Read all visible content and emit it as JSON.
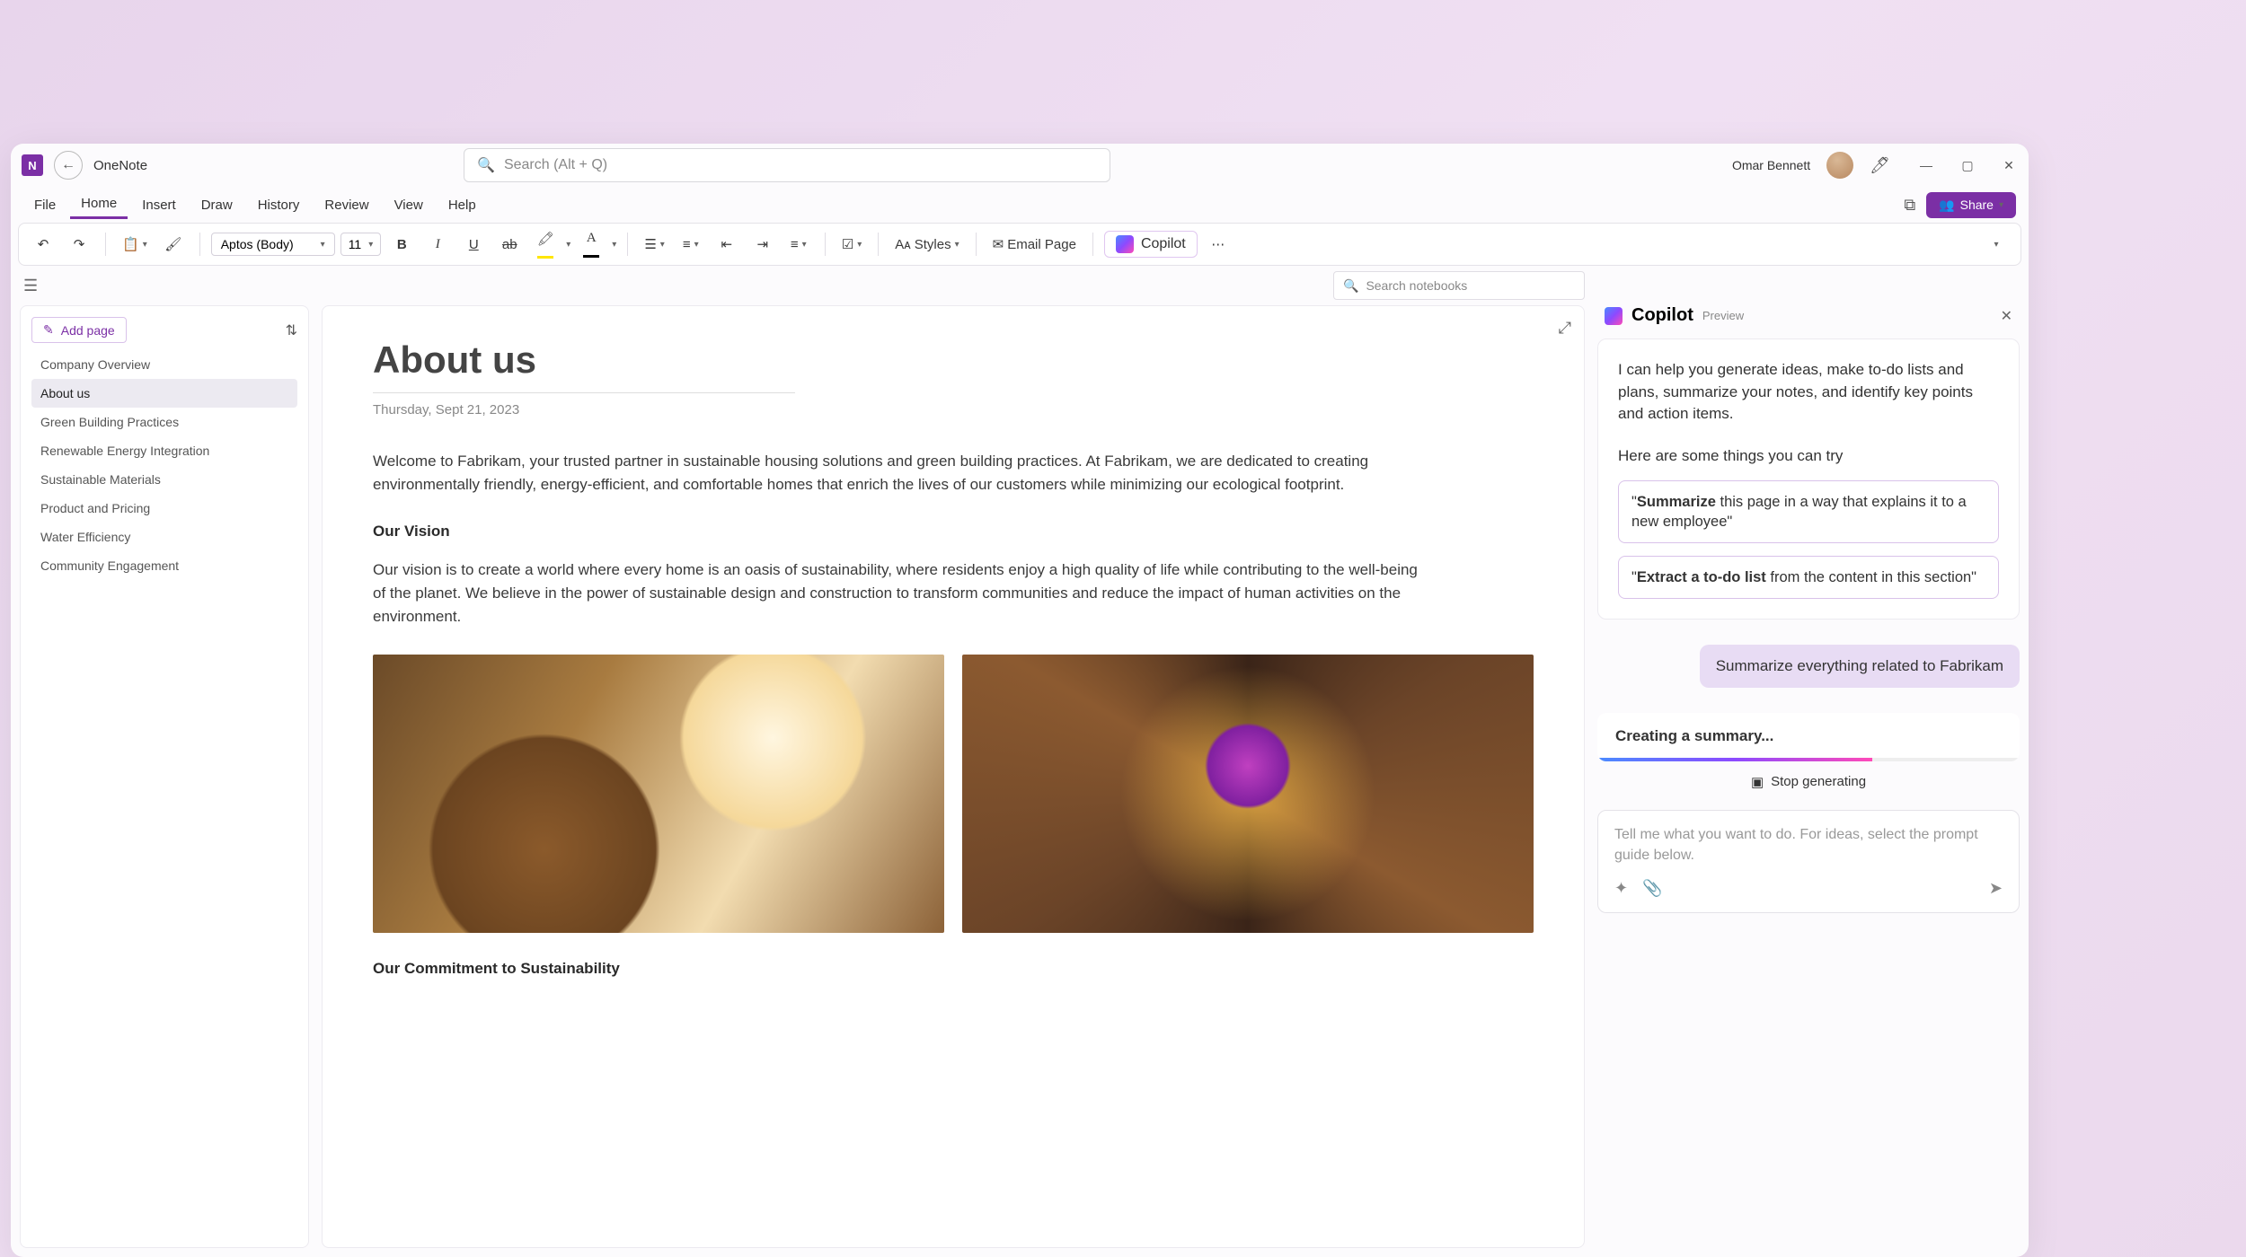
{
  "app": {
    "icon_letter": "N",
    "name": "OneNote",
    "search_placeholder": "Search (Alt + Q)",
    "username": "Omar Bennett"
  },
  "window_controls": {
    "minimize": "—",
    "maximize": "▢",
    "close": "✕"
  },
  "tabs": {
    "items": [
      "File",
      "Home",
      "Insert",
      "Draw",
      "History",
      "Review",
      "View",
      "Help"
    ],
    "active": "Home",
    "share_label": "Share"
  },
  "ribbon": {
    "font": "Aptos (Body)",
    "size": "11",
    "styles_label": "Styles",
    "email_label": "Email Page",
    "copilot_label": "Copilot"
  },
  "search_notebooks_placeholder": "Search notebooks",
  "sidebar": {
    "add_page_label": "Add page",
    "pages": [
      "Company Overview",
      "About us",
      "Green Building Practices",
      "Renewable Energy Integration",
      "Sustainable Materials",
      "Product and Pricing",
      "Water Efficiency",
      "Community Engagement"
    ],
    "active_index": 1
  },
  "page": {
    "title": "About us",
    "date": "Thursday, Sept 21, 2023",
    "intro": "Welcome to Fabrikam, your trusted partner in sustainable housing solutions and green building practices. At Fabrikam, we are dedicated to creating environmentally friendly, energy-efficient, and comfortable homes that enrich the lives of our customers while minimizing our ecological footprint.",
    "vision_head": "Our Vision",
    "vision_body": "Our vision is to create a world where every home is an oasis of sustainability, where residents enjoy a high quality of life while contributing to the well-being of the planet. We believe in the power of sustainable design and construction to transform communities and reduce the impact of human activities on the environment.",
    "commitment_head": "Our Commitment to Sustainability"
  },
  "copilot": {
    "title": "Copilot",
    "preview": "Preview",
    "intro": "I can help you generate ideas, make to-do lists and plans, summarize your notes, and identify key points and action items.",
    "try_label": "Here are some things you can try",
    "suggestion1_bold": "Summarize",
    "suggestion1_rest": " this page in a way that explains it to a new employee\"",
    "suggestion2_bold": "Extract a to-do list",
    "suggestion2_rest": " from the content in this section\"",
    "user_msg": "Summarize everything related to Fabrikam",
    "creating": "Creating a summary...",
    "stop_label": "Stop generating",
    "input_placeholder": "Tell me what you want to do. For ideas, select the prompt guide below."
  }
}
